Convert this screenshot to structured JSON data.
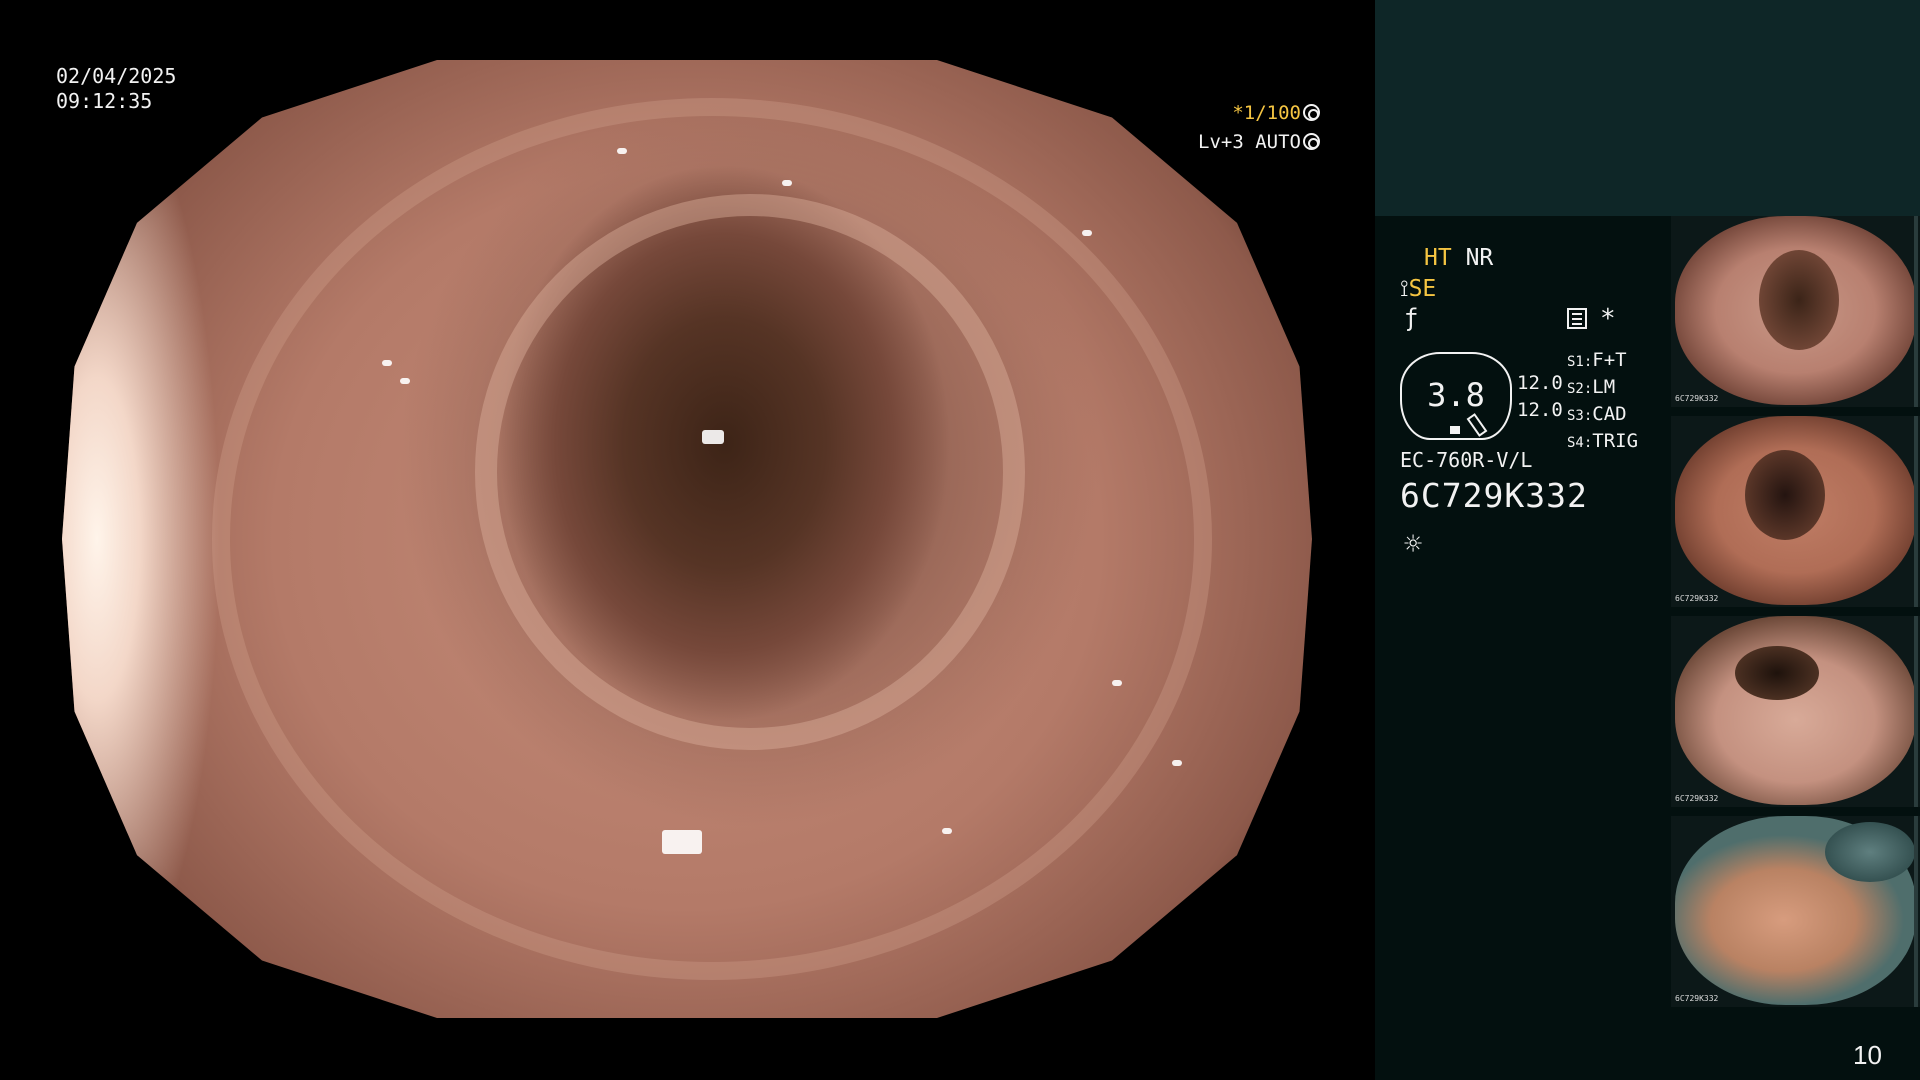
{
  "overlay": {
    "date": "02/04/2025",
    "time": "09:12:35",
    "shutter_value": "*1/100",
    "level": "Lv+3",
    "mode": "AUTO"
  },
  "panel": {
    "ht_label": "HT",
    "nr_label": "NR",
    "se_label": "SE",
    "star": "*",
    "dial_value": "3.8",
    "dial_nums": [
      "12.0",
      "12.0"
    ],
    "settings": [
      {
        "key": "S1:",
        "value": "F+T"
      },
      {
        "key": "S2:",
        "value": "LM"
      },
      {
        "key": "S3:",
        "value": "CAD"
      },
      {
        "key": "S4:",
        "value": "TRIG"
      }
    ],
    "model": "EC-760R-V/L",
    "serial": "6C729K332"
  },
  "thumbnails": [
    {
      "label": "6C729K332"
    },
    {
      "label": "6C729K332"
    },
    {
      "label": "6C729K332"
    },
    {
      "label": "6C729K332"
    }
  ],
  "page_number": "10",
  "icons": {
    "shutter": "shutter-icon",
    "auto": "auto-iris-icon",
    "scissors": "scissors-icon",
    "f": "f-mode-icon",
    "menu": "menu-icon",
    "light": "light-source-icon"
  }
}
